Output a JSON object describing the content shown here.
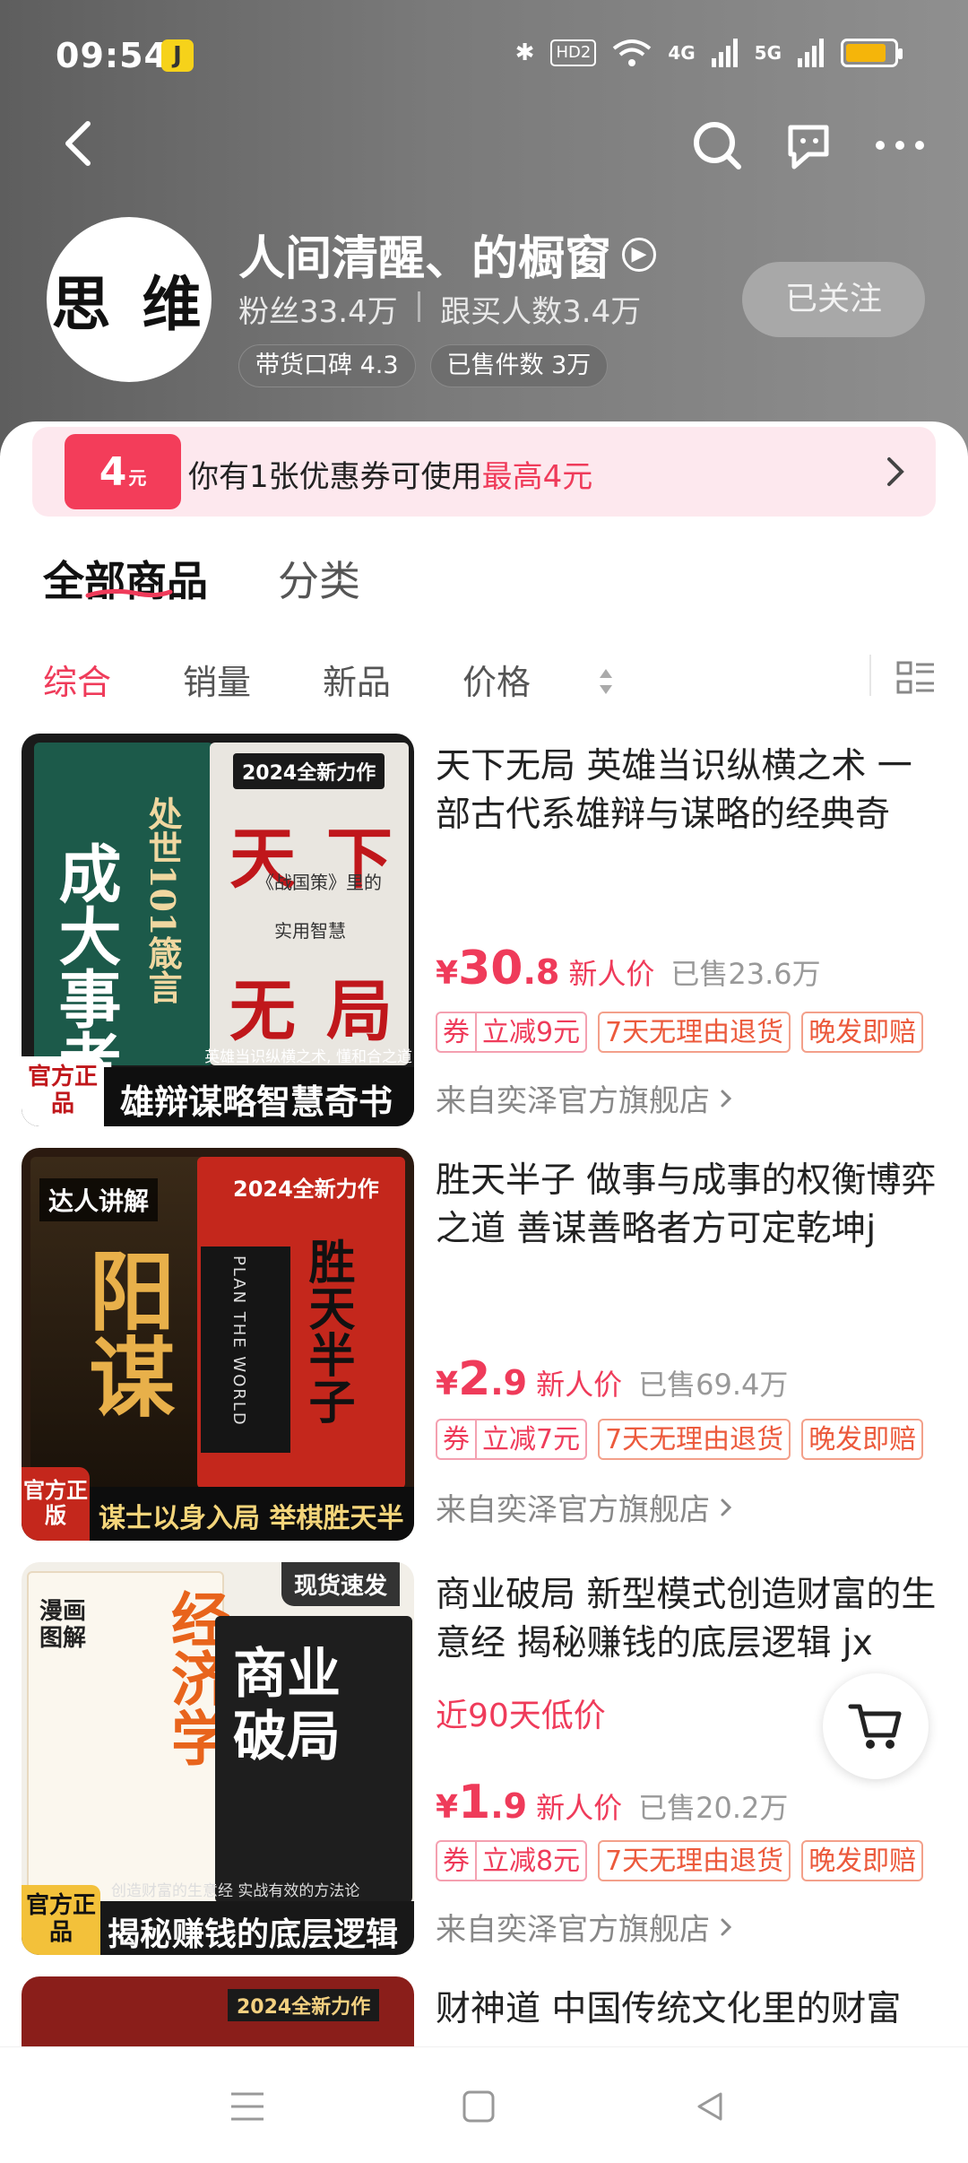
{
  "status": {
    "time": "09:54",
    "notif": "J",
    "hd": "HD2",
    "net1": "4G",
    "net2": "5G"
  },
  "shop": {
    "avatar_text": "思 维",
    "name": "人间清醒、的橱窗",
    "fans": "粉丝33.4万",
    "buyers": "跟买人数3.4万",
    "rating": "带货口碑 4.3",
    "sold": "已售件数 3万",
    "follow_label": "已关注"
  },
  "coupon": {
    "amount": "4",
    "unit": "元",
    "text": "你有1张优惠券可使用",
    "highlight": "最高4元"
  },
  "tabs": {
    "all": "全部商品",
    "category": "分类"
  },
  "sort": {
    "general": "综合",
    "sales": "销量",
    "new": "新品",
    "price": "价格"
  },
  "products": [
    {
      "title": "天下无局 英雄当识纵横之术 一部古代系雄辩与谋略的经典奇",
      "price_int": "30",
      "price_dec": ".8",
      "new_label": "新人价",
      "sold": "已售23.6万",
      "coupon_q": "券",
      "coupon_v": "立减9元",
      "tag2": "7天无理由退货",
      "tag3": "晚发即赔",
      "store": "来自奕泽官方旗舰店",
      "cover": {
        "badge": "2024全新力作",
        "left_title": "成大事者",
        "left_sub": "处世101箴言",
        "right_title1": "天",
        "right_title2": "下",
        "right_title3": "无",
        "right_title4": "局",
        "right_sub": "《战国策》里的",
        "right_sub2": "实用智慧",
        "tagline": "英雄当识纵横之术, 懂和合之道",
        "official": "官方正品",
        "banner": "雄辩谋略智慧奇书"
      }
    },
    {
      "title": "胜天半子 做事与成事的权衡博弈之道 善谋善略者方可定乾坤j",
      "price_int": "2",
      "price_dec": ".9",
      "new_label": "新人价",
      "sold": "已售69.4万",
      "coupon_q": "券",
      "coupon_v": "立减7元",
      "tag2": "7天无理由退货",
      "tag3": "晚发即赔",
      "store": "来自奕泽官方旗舰店",
      "cover": {
        "badge": "2024全新力作",
        "talent": "达人讲解",
        "left_title": "阳谋",
        "right_title": "胜天半子",
        "right_sub": "PLAN THE WORLD",
        "official": "官方正版",
        "banner": "谋士以身入局 举棋胜天半子"
      }
    },
    {
      "title": "商业破局 新型模式创造财富的生意经 揭秘赚钱的底层逻辑 jx",
      "low_price": "近90天低价",
      "price_int": "1",
      "price_dec": ".9",
      "new_label": "新人价",
      "sold": "已售20.2万",
      "coupon_q": "券",
      "coupon_v": "立减8元",
      "tag2": "7天无理由退货",
      "tag3": "晚发即赔",
      "store": "来自奕泽官方旗舰店",
      "cover": {
        "badge": "现货速发",
        "left_title": "经济学",
        "left_sub": "漫画图解",
        "right_title": "商业破局",
        "official": "官方正品",
        "banner": "揭秘赚钱的底层逻辑",
        "tagline": "创造财富的生意经 实战有效的方法论"
      }
    },
    {
      "title": "财神道 中国传统文化里的财富",
      "cover": {
        "badge": "2024全新力作"
      }
    }
  ]
}
